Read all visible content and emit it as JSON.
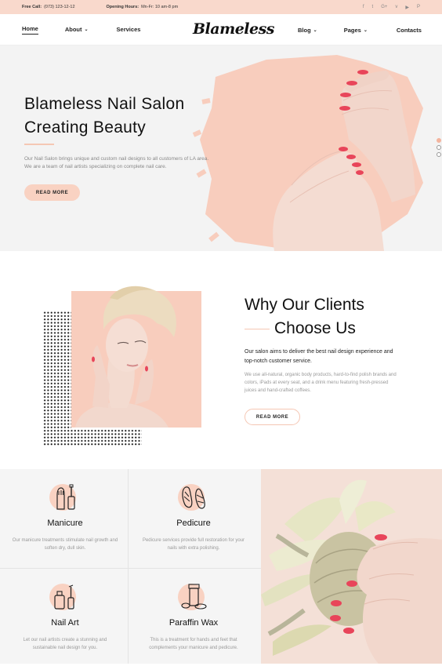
{
  "topbar": {
    "call_label": "Free Call:",
    "call_value": "(073) 123-12-12",
    "hours_label": "Opening Hours:",
    "hours_value": "Mn-Fr: 10 am-8 pm",
    "social": [
      "f",
      "t",
      "G+",
      "v",
      "b",
      "P"
    ]
  },
  "nav": {
    "logo": "Blameless",
    "items": [
      "Home",
      "About",
      "Services",
      "Blog",
      "Pages",
      "Contacts"
    ]
  },
  "hero": {
    "title_line1": "Blameless Nail Salon",
    "title_line2": "Creating Beauty",
    "text": "Our Nail Salon brings unique and custom nail designs to all customers of LA area. We are a team of nail artists specializing on complete nail care.",
    "button": "READ MORE"
  },
  "why": {
    "title_line1": "Why Our Clients",
    "title_line2": "Choose Us",
    "lead": "Our salon aims to deliver the best nail design experience and top-notch customer service.",
    "text": "We use all-natural, organic body products, hard-to-find polish brands and colors, iPads at every seat, and a drink menu featuring fresh-pressed juices and hand-crafted coffees.",
    "button": "READ MORE"
  },
  "services": [
    {
      "title": "Manicure",
      "text": "Our manicure treatments stimulate nail growth and soften dry, dull skin.",
      "icon": "manicure-icon"
    },
    {
      "title": "Pedicure",
      "text": "Pedicure services provide full restoration for your nails with extra polishing.",
      "icon": "pedicure-icon"
    },
    {
      "title": "Nail Art",
      "text": "Let our nail artists create a stunning and sustainable nail design for you.",
      "icon": "nail-art-icon"
    },
    {
      "title": "Paraffin Wax",
      "text": "This is a treatment for hands and feet that complements your manicure and pedicure.",
      "icon": "paraffin-wax-icon"
    }
  ],
  "colors": {
    "accent": "#f9d2c2",
    "topbar": "#f9d9cc",
    "nail": "#e8455a"
  }
}
